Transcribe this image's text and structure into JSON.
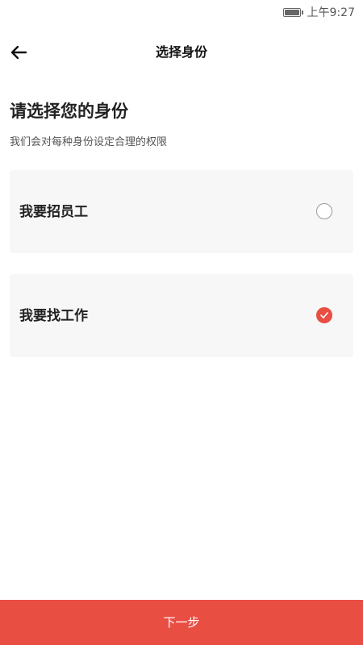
{
  "status_bar": {
    "time": "上午9:27",
    "battery_icon": "battery-icon"
  },
  "nav": {
    "back_icon": "arrow-left-icon",
    "title": "选择身份"
  },
  "main": {
    "heading": "请选择您的身份",
    "subheading": "我们会对每种身份设定合理的权限"
  },
  "options": [
    {
      "label": "我要招员工",
      "selected": false
    },
    {
      "label": "我要找工作",
      "selected": true
    }
  ],
  "footer": {
    "next_label": "下一步"
  },
  "colors": {
    "accent": "#e94e43",
    "card_background": "#f7f7f7",
    "text_primary": "#222222",
    "text_secondary": "#555555"
  }
}
